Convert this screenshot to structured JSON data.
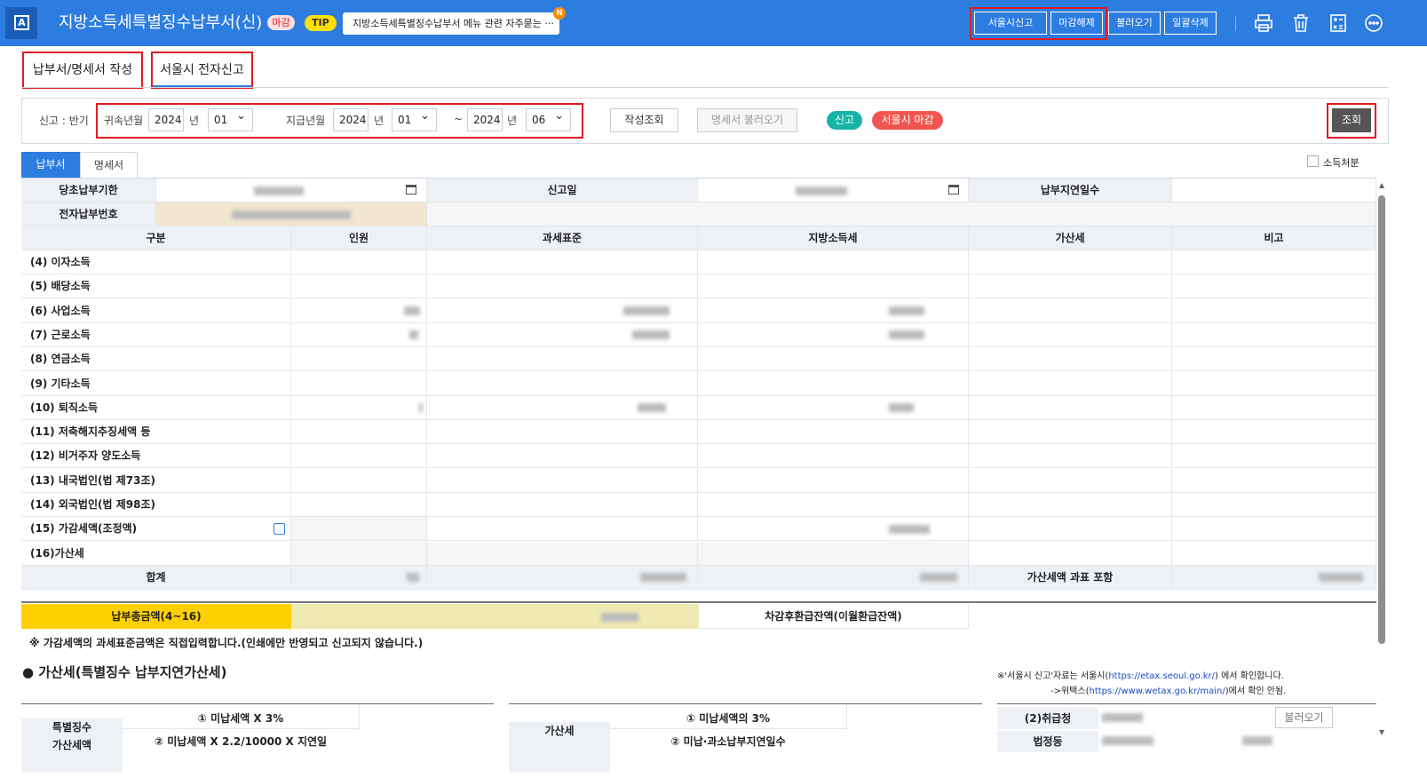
{
  "header": {
    "logo": "A",
    "title": "지방소득세특별징수납부서(신)",
    "title_tag": "마감",
    "tip_label": "TIP",
    "tip_text": "지방소득세특별징수납부서 메뉴 관련 자주묻는 ···",
    "tip_new_badge": "N",
    "buttons": {
      "seoul_report": "서울시신고",
      "close_release": "마감해제",
      "load": "불러오기",
      "delete_all": "일괄삭제"
    },
    "icons": [
      "print-icon",
      "trash-icon",
      "calculator-icon",
      "menu-dots-icon"
    ]
  },
  "tabs": {
    "write": "납부서/명세서 작성",
    "seoul_efile": "서울시 전자신고"
  },
  "filter": {
    "report_label": "신고 : 반기",
    "attr_label": "귀속년월",
    "attr_year": "2024",
    "attr_month": "01",
    "year_unit": "년",
    "pay_label": "지급년월",
    "pay_year_from": "2024",
    "pay_month_from": "01",
    "tilde": "~",
    "pay_year_to": "2024",
    "pay_month_to": "06",
    "btn_write_query": "작성조회",
    "btn_load_statement": "명세서 불러오기",
    "badge_report": "신고",
    "badge_seoul_close": "서울시 마감",
    "btn_search": "조회"
  },
  "subtabs": {
    "payment": "납부서",
    "statement": "명세서",
    "income_disposal": "소득처분"
  },
  "form": {
    "due_date_label": "당초납부기한",
    "report_date_label": "신고일",
    "late_days_label": "납부지연일수",
    "epay_no_label": "전자납부번호",
    "columns": [
      "구분",
      "인원",
      "과세표준",
      "지방소득세",
      "가산세",
      "비고"
    ],
    "rows": [
      "(4) 이자소득",
      "(5) 배당소득",
      "(6) 사업소득",
      "(7) 근로소득",
      "(8) 연금소득",
      "(9) 기타소득",
      "(10) 퇴직소득",
      "(11) 저축해지추징세액 등",
      "(12) 비거주자 양도소득",
      "(13) 내국법인(법 제73조)",
      "(14) 외국법인(법 제98조)",
      "(15) 가감세액(조정액)",
      "(16)가산세"
    ],
    "total_label": "합계",
    "penalty_incl_label": "가산세액 과표 포함"
  },
  "summary": {
    "total_payment_label": "납부총금액(4~16)",
    "refund_balance_label": "차감후환급잔액(이월환급잔액)"
  },
  "note": "※ 가감세액의 과세표준금액은 직접입력합니다.(인쇄에만 반영되고 신고되지 않습니다.)",
  "penalty_section": {
    "title": "● 가산세(특별징수 납부지연가산세)",
    "seoul_note_1a": "※'서울시 신고'자료는 서울시(",
    "seoul_url": "https://etax.seoul.go.kr/",
    "seoul_note_1b": ") 에서 확인합니다.",
    "seoul_note_2a": "->위택스(",
    "wetax_url": "https://www.wetax.go.kr/main/",
    "seoul_note_2b": ")에서 확인 안됨.",
    "left_header": "특별징수",
    "left_header2": "가산세액",
    "left_row1": "① 미납세액 X 3%",
    "left_row2": "② 미납세액 X 2.2/10000 X 지연일",
    "mid_header": "가산세",
    "mid_row1": "① 미납세액의 3%",
    "mid_row2": "② 미납·과소납부지연일수",
    "right_row1": "(2)취급청",
    "right_row2": "법정동",
    "right_btn": "불러오기"
  }
}
